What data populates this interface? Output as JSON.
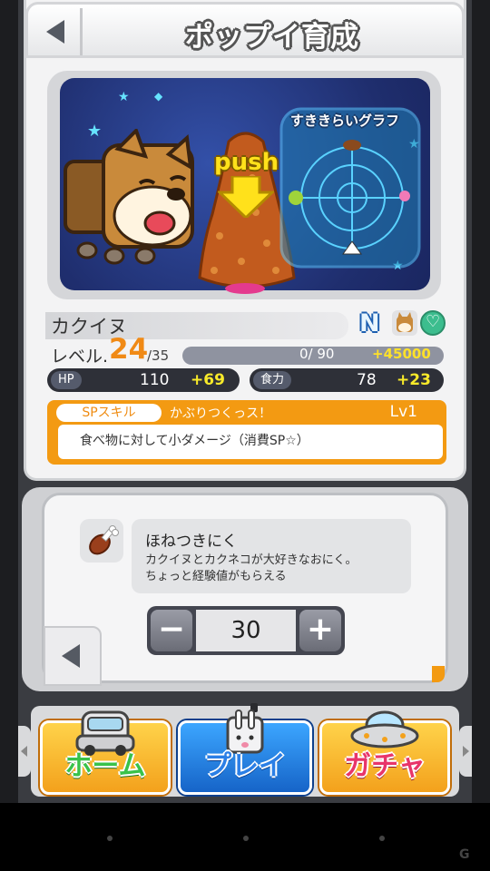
{
  "header": {
    "title": "ポップイ育成"
  },
  "scene": {
    "push_label": "push",
    "graph_label": "すききらいグラフ"
  },
  "pet": {
    "name": "カクイヌ",
    "rarity": "N",
    "level_label": "レベル.",
    "level": "24",
    "level_max": "/35",
    "exp_text": "0/  90",
    "exp_bonus": "+45000",
    "exp_progress": 0
  },
  "stats": {
    "hp": {
      "label": "HP",
      "value": "110",
      "bonus": "+69"
    },
    "power": {
      "label": "食力",
      "value": "78",
      "bonus": "+23"
    }
  },
  "skill": {
    "tag": "SPスキル",
    "name": "かぶりつくっス！",
    "level": "Lv1",
    "description": "食べ物に対して小ダメージ（消費SP☆）"
  },
  "item": {
    "name": "ほねつきにく",
    "description_line1": "カクイヌとカクネコが大好きなおにく。",
    "description_line2": "ちょっと経験値がもらえる",
    "quantity": "30",
    "minus": "−",
    "plus": "+"
  },
  "nav": {
    "home": "ホーム",
    "play": "プレイ",
    "gacha": "ガチャ"
  },
  "colors": {
    "accent_orange": "#f39a12",
    "level_orange": "#f08a16",
    "stat_bonus_yellow": "#f8ea2a",
    "play_blue": "#1664c8"
  }
}
